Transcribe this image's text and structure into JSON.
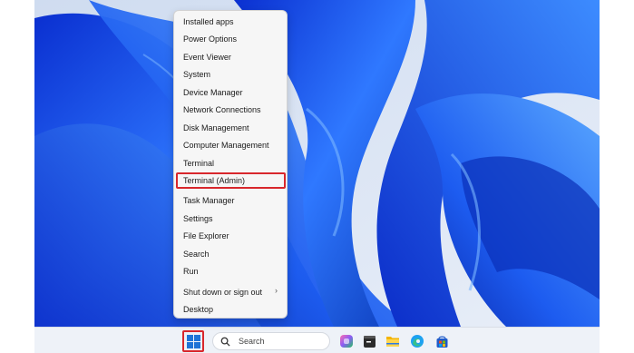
{
  "menu": {
    "items": [
      {
        "label": "Installed apps"
      },
      {
        "label": "Power Options"
      },
      {
        "label": "Event Viewer"
      },
      {
        "label": "System"
      },
      {
        "label": "Device Manager"
      },
      {
        "label": "Network Connections"
      },
      {
        "label": "Disk Management"
      },
      {
        "label": "Computer Management"
      },
      {
        "label": "Terminal"
      },
      {
        "label": "Terminal (Admin)"
      },
      {
        "label": "Task Manager"
      },
      {
        "label": "Settings"
      },
      {
        "label": "File Explorer"
      },
      {
        "label": "Search"
      },
      {
        "label": "Run"
      },
      {
        "label": "Shut down or sign out"
      },
      {
        "label": "Desktop"
      }
    ],
    "submenu_arrow": "›"
  },
  "taskbar": {
    "search_placeholder": "Search",
    "apps": [
      "copilot-icon",
      "terminal-app-icon",
      "file-explorer-icon",
      "edge-browser-icon",
      "microsoft-store-icon"
    ]
  },
  "colors": {
    "highlight_border": "#d8272c",
    "wallpaper_blue": "#1f5ff0",
    "accent": "#1f74d6"
  }
}
